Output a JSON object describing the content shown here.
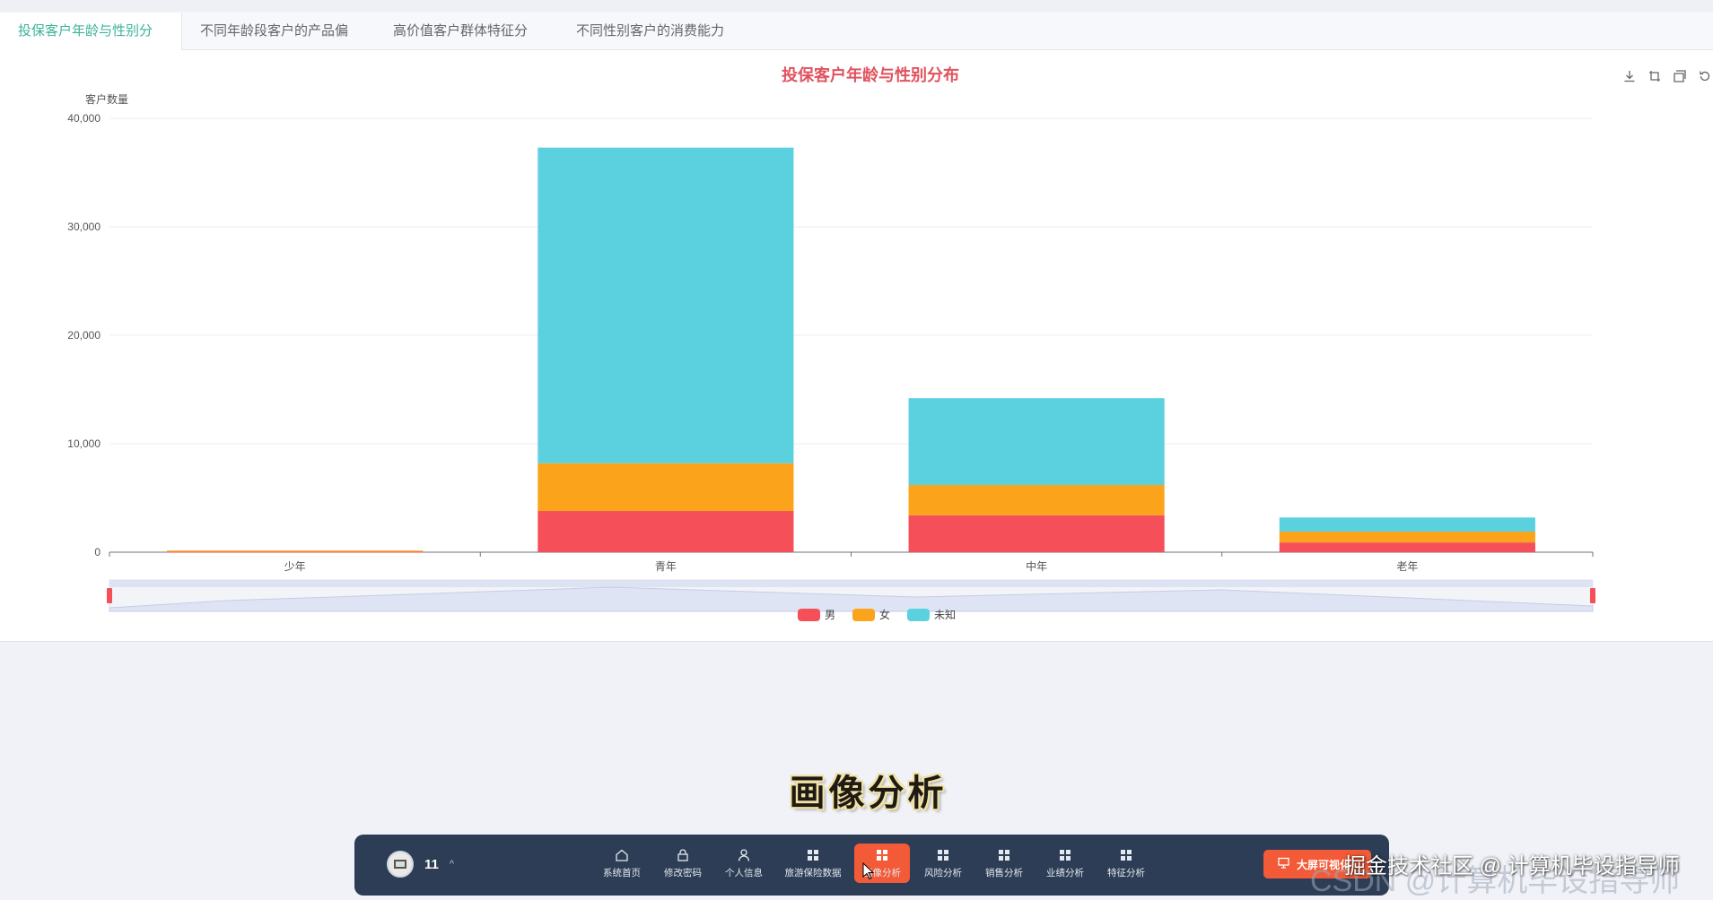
{
  "tabs": [
    {
      "label": "投保客户年龄与性别分布",
      "active": true
    },
    {
      "label": "不同年龄段客户的产品偏好",
      "active": false
    },
    {
      "label": "高价值客户群体特征分析",
      "active": false
    },
    {
      "label": "不同性别客户的消费能力分析",
      "active": false
    }
  ],
  "toolbox": [
    "download-icon",
    "zoom-icon",
    "zoom-reset-icon",
    "restore-icon"
  ],
  "chart_data": {
    "type": "bar",
    "stacked": true,
    "title": "投保客户年龄与性别分布",
    "ylabel": "客户数量",
    "xlabel": "",
    "categories": [
      "少年",
      "青年",
      "中年",
      "老年"
    ],
    "series": [
      {
        "name": "男",
        "color": "#f5505a",
        "values": [
          50,
          3800,
          3400,
          900
        ]
      },
      {
        "name": "女",
        "color": "#fca31c",
        "values": [
          100,
          4400,
          2800,
          1000
        ]
      },
      {
        "name": "未知",
        "color": "#5bd1e0",
        "values": [
          0,
          29100,
          8000,
          1300
        ]
      }
    ],
    "ylim": [
      0,
      40000
    ],
    "yticks": [
      0,
      10000,
      20000,
      30000,
      40000
    ],
    "ytick_labels": [
      "0",
      "10,000",
      "20,000",
      "30,000",
      "40,000"
    ],
    "grid": true,
    "legend_position": "bottom-center",
    "datazoom": true
  },
  "subtitle": "画像分析",
  "dock": {
    "user_name": "11",
    "nav": [
      {
        "label": "系统首页",
        "icon": "home-icon",
        "active": false
      },
      {
        "label": "修改密码",
        "icon": "lock-icon",
        "active": false
      },
      {
        "label": "个人信息",
        "icon": "user-icon",
        "active": false
      },
      {
        "label": "旅游保险数据",
        "icon": "grid-icon",
        "active": false
      },
      {
        "label": "画像分析",
        "icon": "grid-icon",
        "active": true
      },
      {
        "label": "风险分析",
        "icon": "grid-icon",
        "active": false
      },
      {
        "label": "销售分析",
        "icon": "grid-icon",
        "active": false
      },
      {
        "label": "业绩分析",
        "icon": "grid-icon",
        "active": false
      },
      {
        "label": "特征分析",
        "icon": "grid-icon",
        "active": false
      }
    ],
    "big_screen_label": "大屏可视化"
  },
  "watermark": "掘金技术社区 @ 计算机毕设指导师",
  "watermark_bg": "CSDN @计算机毕设指导师",
  "colors": {
    "accent": "#3bb39a",
    "title": "#e0535e",
    "dock": "#2c3d55",
    "active": "#f25a38"
  }
}
